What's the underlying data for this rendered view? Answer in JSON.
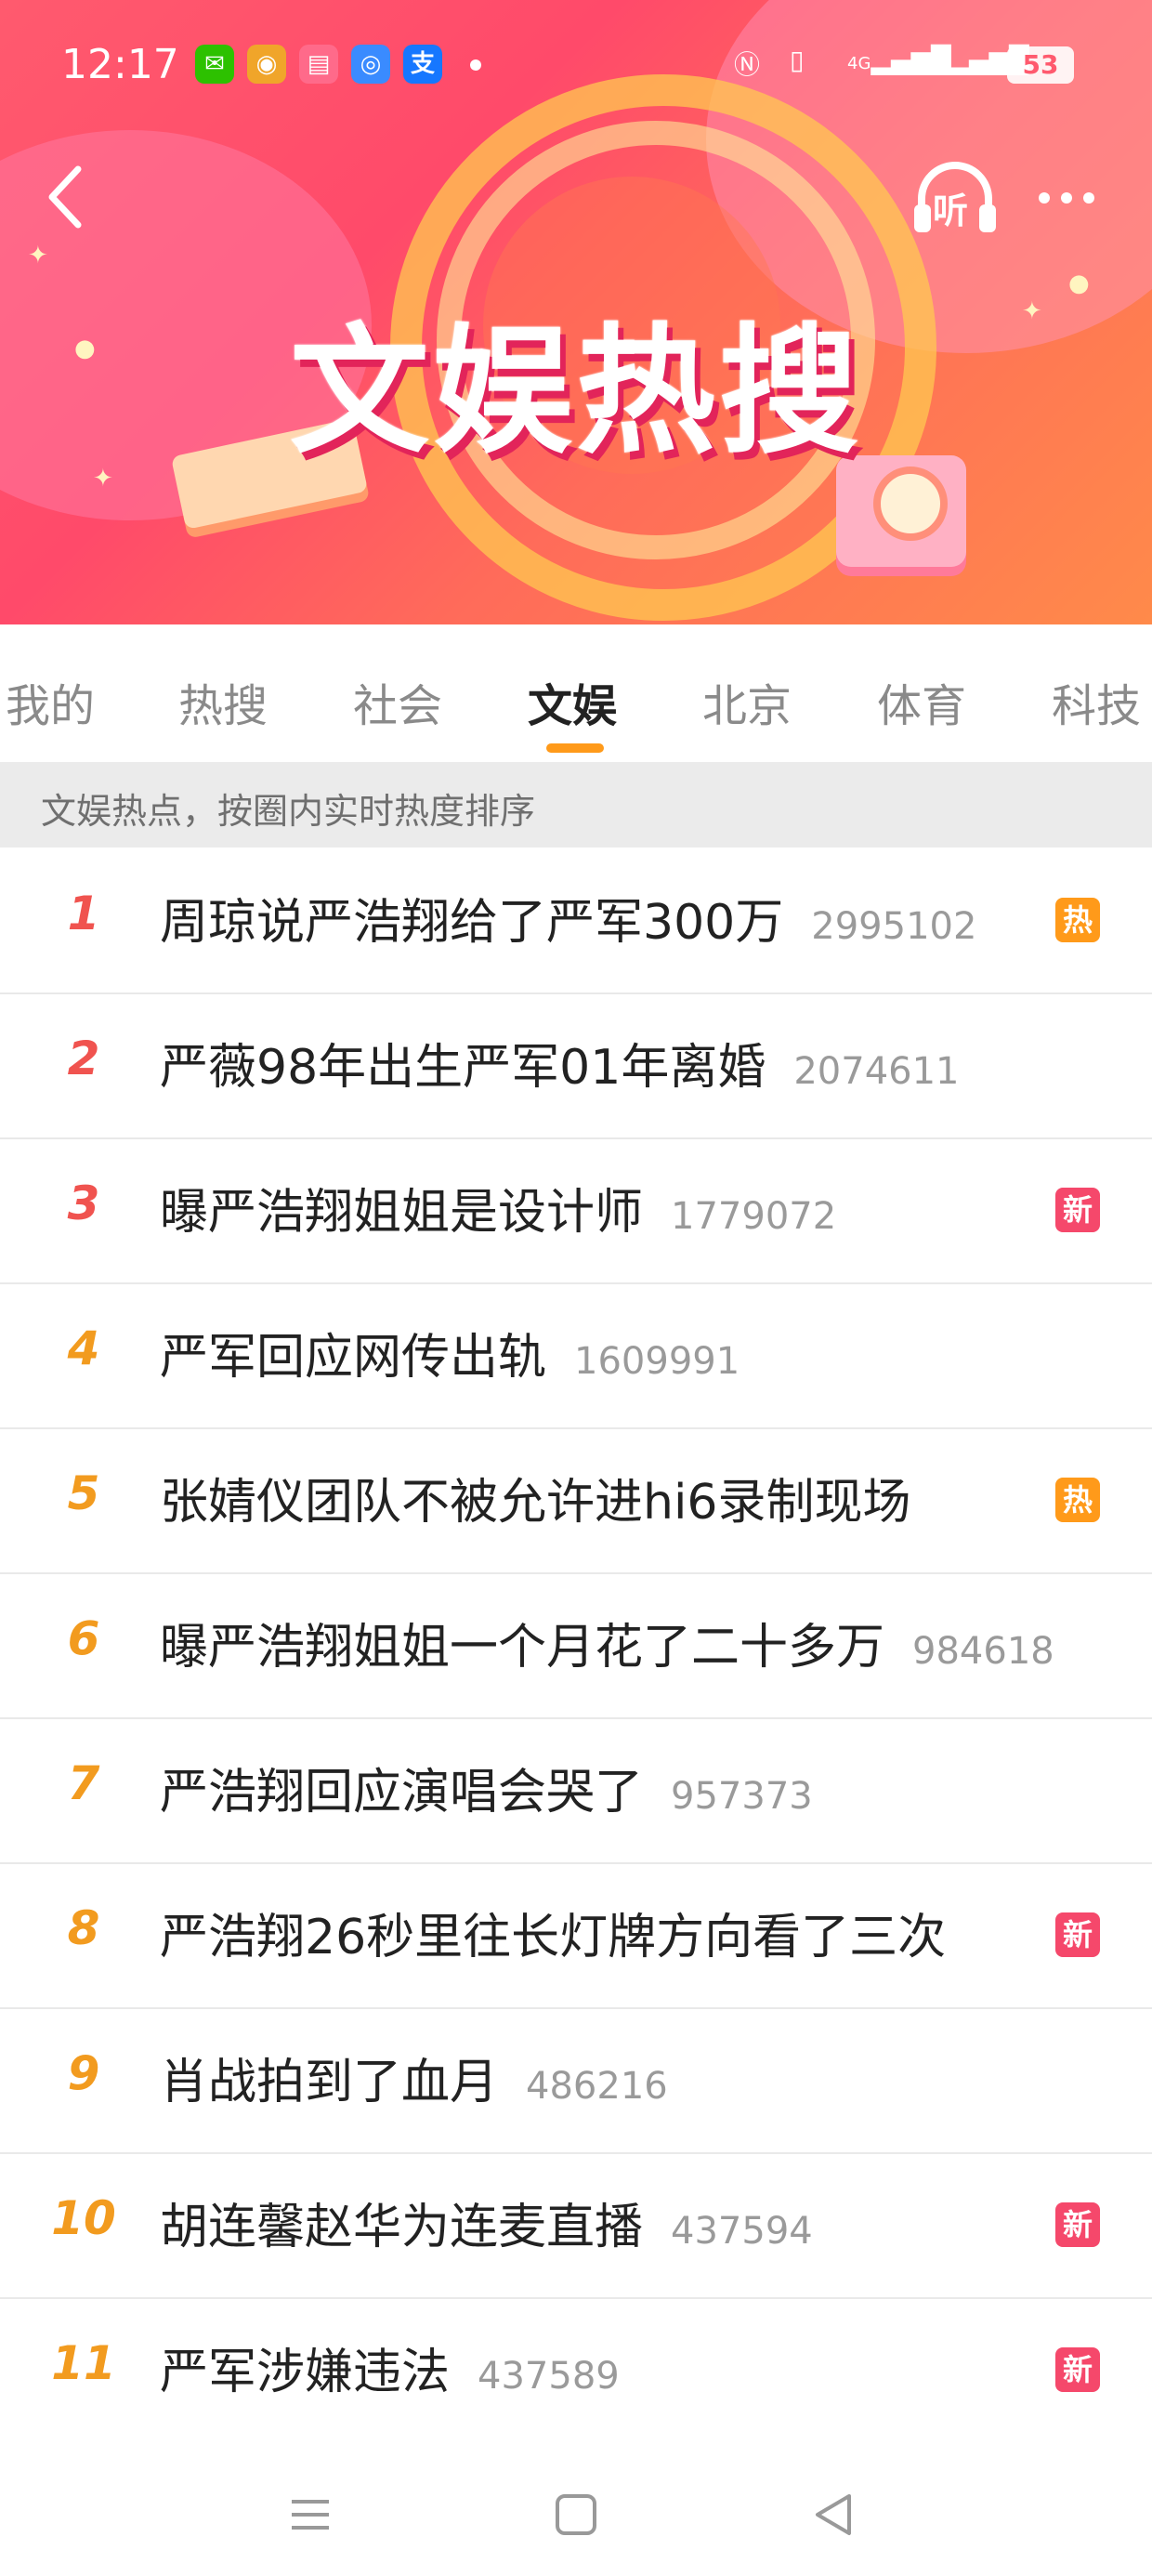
{
  "status_bar": {
    "time": "12:17",
    "apps": [
      {
        "icon": "wechat-icon",
        "color": "#2dc100",
        "glyph": "✉"
      },
      {
        "icon": "weibo-icon",
        "color": "#f0a52a",
        "glyph": "◉"
      },
      {
        "icon": "weibo-intl-icon",
        "color": "#ff6a8a",
        "glyph": "▤"
      },
      {
        "icon": "baidu-map-icon",
        "color": "#3a8bff",
        "glyph": "◎"
      },
      {
        "icon": "alipay-icon",
        "color": "#1677ff",
        "glyph": "支"
      }
    ],
    "network_labels": [
      "4G",
      "4G"
    ],
    "battery": "53"
  },
  "header": {
    "banner_title": "文娱热搜",
    "listen_label": "听"
  },
  "tabs": [
    {
      "label": "我的",
      "active": false
    },
    {
      "label": "热搜",
      "active": false
    },
    {
      "label": "社会",
      "active": false
    },
    {
      "label": "文娱",
      "active": true
    },
    {
      "label": "北京",
      "active": false
    },
    {
      "label": "体育",
      "active": false
    },
    {
      "label": "科技",
      "active": false
    }
  ],
  "subheading": "文娱热点，按圈内实时热度排序",
  "colors": {
    "rank_top": "#f0534f",
    "rank_other": "#f29b1f",
    "badge_hot": "#ff9a1a",
    "badge_new": "#f5486b",
    "tab_underline": "#ff9a1a"
  },
  "items": [
    {
      "rank": "1",
      "title": "周琼说严浩翔给了严军300万",
      "count": "2995102",
      "badge": "热"
    },
    {
      "rank": "2",
      "title": "严薇98年出生严军01年离婚",
      "count": "2074611",
      "badge": ""
    },
    {
      "rank": "3",
      "title": "曝严浩翔姐姐是设计师",
      "count": "1779072",
      "badge": "新"
    },
    {
      "rank": "4",
      "title": "严军回应网传出轨",
      "count": "1609991",
      "badge": ""
    },
    {
      "rank": "5",
      "title": "张婧仪团队不被允许进hi6录制现场",
      "count": "",
      "badge": "热"
    },
    {
      "rank": "6",
      "title": "曝严浩翔姐姐一个月花了二十多万",
      "count": "984618",
      "badge": ""
    },
    {
      "rank": "7",
      "title": "严浩翔回应演唱会哭了",
      "count": "957373",
      "badge": ""
    },
    {
      "rank": "8",
      "title": "严浩翔26秒里往长灯牌方向看了三次",
      "count": "",
      "badge": "新"
    },
    {
      "rank": "9",
      "title": "肖战拍到了血月",
      "count": "486216",
      "badge": ""
    },
    {
      "rank": "10",
      "title": "胡连馨赵华为连麦直播",
      "count": "437594",
      "badge": "新"
    },
    {
      "rank": "11",
      "title": "严军涉嫌违法",
      "count": "437589",
      "badge": "新"
    }
  ],
  "nav": [
    "menu-icon",
    "home-icon",
    "back-triangle-icon"
  ]
}
